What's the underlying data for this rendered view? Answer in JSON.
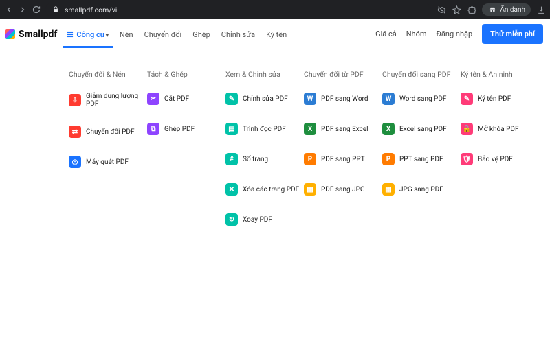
{
  "chrome": {
    "url": "smallpdf.com/vi",
    "incognito": "Ẩn danh"
  },
  "header": {
    "brand": "Smallpdf",
    "nav": {
      "tools": "Công cụ",
      "compress": "Nén",
      "convert": "Chuyển đổi",
      "merge": "Ghép",
      "edit": "Chỉnh sửa",
      "sign": "Ký tên"
    },
    "right": {
      "pricing": "Giá cả",
      "teams": "Nhóm",
      "login": "Đăng nhập",
      "cta": "Thử miễn phí"
    }
  },
  "columns": [
    {
      "title": "Chuyển đổi & Nén",
      "items": [
        {
          "label": "Giảm dung lượng PDF",
          "icon": "⇩",
          "color": "#ff3b30"
        },
        {
          "label": "Chuyển đổi PDF",
          "icon": "⇄",
          "color": "#ff3b30"
        },
        {
          "label": "Máy quét PDF",
          "icon": "◎",
          "color": "#1a73ff"
        }
      ]
    },
    {
      "title": "Tách & Ghép",
      "items": [
        {
          "label": "Cắt PDF",
          "icon": "✂",
          "color": "#8e44ff"
        },
        {
          "label": "Ghép PDF",
          "icon": "⧉",
          "color": "#8e44ff"
        }
      ]
    },
    {
      "title": "Xem & Chỉnh sửa",
      "items": [
        {
          "label": "Chỉnh sửa PDF",
          "icon": "✎",
          "color": "#00c2a8"
        },
        {
          "label": "Trình đọc PDF",
          "icon": "▤",
          "color": "#00c2a8"
        },
        {
          "label": "Số trang",
          "icon": "#",
          "color": "#00c2a8"
        },
        {
          "label": "Xóa các trang PDF",
          "icon": "✕",
          "color": "#00c2a8"
        },
        {
          "label": "Xoay PDF",
          "icon": "↻",
          "color": "#00c2a8"
        }
      ]
    },
    {
      "title": "Chuyển đổi từ PDF",
      "items": [
        {
          "label": "PDF sang Word",
          "icon": "W",
          "color": "#2b7cd3"
        },
        {
          "label": "PDF sang Excel",
          "icon": "X",
          "color": "#1e8e3e"
        },
        {
          "label": "PDF sang PPT",
          "icon": "P",
          "color": "#ff7b00"
        },
        {
          "label": "PDF sang JPG",
          "icon": "▦",
          "color": "#ffb000"
        }
      ]
    },
    {
      "title": "Chuyển đổi sang PDF",
      "items": [
        {
          "label": "Word sang PDF",
          "icon": "W",
          "color": "#2b7cd3"
        },
        {
          "label": "Excel sang PDF",
          "icon": "X",
          "color": "#1e8e3e"
        },
        {
          "label": "PPT sang PDF",
          "icon": "P",
          "color": "#ff7b00"
        },
        {
          "label": "JPG sang PDF",
          "icon": "▦",
          "color": "#ffb000"
        }
      ]
    },
    {
      "title": "Ký tên & An ninh",
      "items": [
        {
          "label": "Ký tên PDF",
          "icon": "✎",
          "color": "#ff3b78"
        },
        {
          "label": "Mở khóa PDF",
          "icon": "🔓",
          "color": "#ff3b78"
        },
        {
          "label": "Bảo vệ PDF",
          "icon": "🛡",
          "color": "#ff3b78"
        }
      ]
    }
  ]
}
